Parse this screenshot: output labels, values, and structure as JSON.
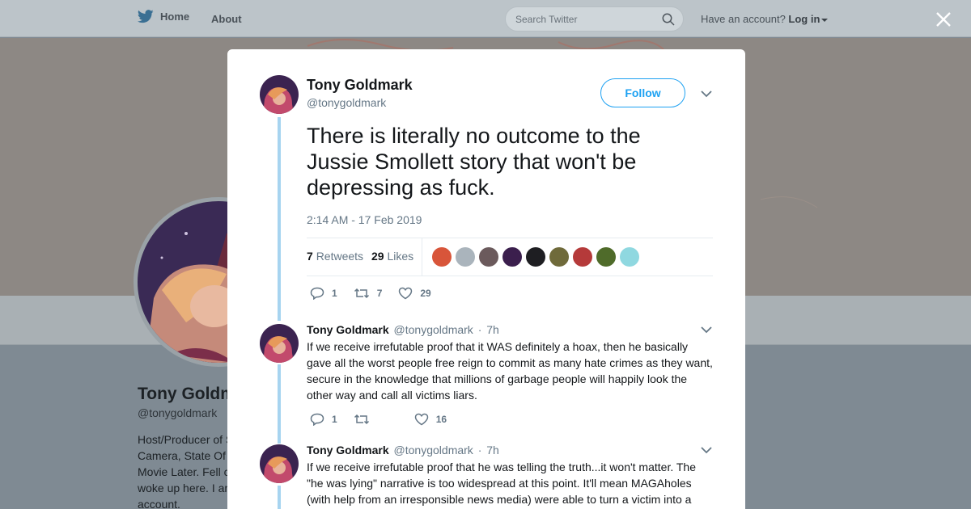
{
  "nav": {
    "home_label": "Home",
    "about_label": "About",
    "search_placeholder": "Search Twitter",
    "account_prompt": "Have an account?",
    "login_label": "Log in",
    "brand_color": "#1da1f2"
  },
  "background_profile": {
    "name": "Tony Goldmark",
    "handle": "@tonygoldmark",
    "bio_lines": [
      "Host/Producer of S",
      "Camera, State Of",
      "Movie Later. Fell c",
      "woke up here. I ar",
      "account."
    ]
  },
  "tweet": {
    "author_name": "Tony Goldmark",
    "author_handle": "@tonygoldmark",
    "follow_label": "Follow",
    "text": "There is literally no outcome to the Jussie Smollett story that won't be depressing as fuck.",
    "timestamp": "2:14 AM - 17 Feb 2019",
    "retweets_count": "7",
    "retweets_label": "Retweets",
    "likes_count": "29",
    "likes_label": "Likes",
    "actions": {
      "replies": "1",
      "retweets": "7",
      "likes": "29"
    },
    "liker_colors": [
      "#d8553a",
      "#aab4bc",
      "#6b5a5c",
      "#3b1f4d",
      "#1e1e22",
      "#6f6a3a",
      "#b53a3a",
      "#4f6b2a",
      "#8fd8e0"
    ]
  },
  "replies": [
    {
      "author_name": "Tony Goldmark",
      "author_handle": "@tonygoldmark",
      "age": "7h",
      "text": "If we receive irrefutable proof that it WAS definitely a hoax, then he basically gave all the worst people free reign to commit as many hate crimes as they want, secure in the knowledge that millions of garbage people will happily look the other way and call all victims liars.",
      "actions": {
        "replies": "1",
        "retweets": "",
        "likes": "16"
      }
    },
    {
      "author_name": "Tony Goldmark",
      "author_handle": "@tonygoldmark",
      "age": "7h",
      "text": "If we receive irrefutable proof that he was telling the truth...it won't matter. The \"he was lying\" narrative is too widespread at this point. It'll mean MAGAholes (with help from an irresponsible news media) were able to turn a victim into a",
      "actions": {
        "replies": "",
        "retweets": "",
        "likes": ""
      }
    }
  ]
}
